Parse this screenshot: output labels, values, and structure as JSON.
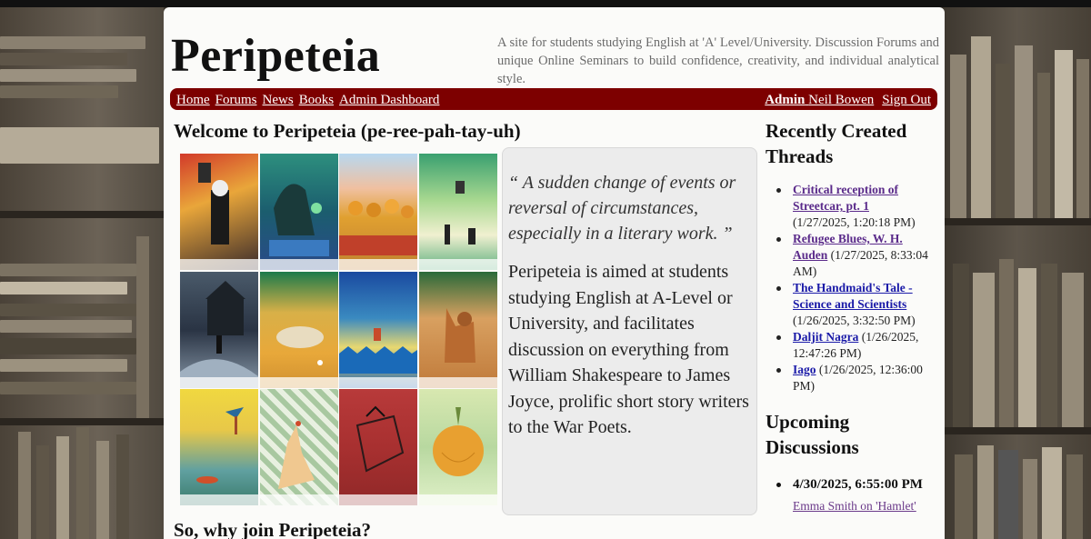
{
  "site": {
    "logo": "Peripeteia",
    "tagline": "A site for students studying English at 'A' Level/University. Discussion Forums and unique Online Seminars to build confidence, creativity, and individual analytical style."
  },
  "nav": {
    "left": [
      "Home",
      "Forums",
      "News",
      "Books",
      "Admin Dashboard"
    ],
    "admin_label": "Admin",
    "user_name": "Neil Bowen",
    "sign_out": "Sign Out"
  },
  "main": {
    "welcome_heading": "Welcome to Peripeteia (pe-ree-pah-tay-uh)",
    "quote": "“ A sudden change of events or reversal of circumstances, especially in a literary work. ”",
    "description": "Peripeteia is aimed at students studying English at A-Level or University, and facilitates discussion on everything from William Shakespeare to James Joyce, prolific short story writers to the War Poets.",
    "why_heading": "So, why join Peripeteia?"
  },
  "sidebar": {
    "recent_title": "Recently Created Threads",
    "threads": [
      {
        "title": "Critical reception of Streetcar, pt. 1",
        "date": "(1/27/2025, 1:20:18 PM)",
        "visited": true
      },
      {
        "title": "Refugee Blues, W. H. Auden",
        "date": "(1/27/2025, 8:33:04 AM)",
        "visited": true
      },
      {
        "title": "The Handmaid's Tale - Science and Scientists",
        "date": "(1/26/2025, 3:32:50 PM)",
        "visited": false
      },
      {
        "title": "Daljit Nagra",
        "date": "(1/26/2025, 12:47:26 PM)",
        "visited": false
      },
      {
        "title": "Iago",
        "date": "(1/26/2025, 12:36:00 PM)",
        "visited": false
      }
    ],
    "upcoming_title": "Upcoming Discussions",
    "events": [
      {
        "datetime": "4/30/2025, 6:55:00 PM",
        "link": "Emma Smith on 'Hamlet'"
      }
    ]
  },
  "colors": {
    "nav_bg": "#7d0000",
    "visited_link": "#5a2a8a",
    "link": "#1a1aa8"
  },
  "tiles": [
    "poster-skeleton-figure",
    "poster-reaper-bed",
    "poster-autumn-trees",
    "poster-field-figures",
    "poster-dark-house",
    "poster-desert-face",
    "poster-blue-figure",
    "poster-fox",
    "poster-bird-landscape",
    "poster-hand-pattern",
    "poster-red-hand",
    "poster-onion"
  ]
}
